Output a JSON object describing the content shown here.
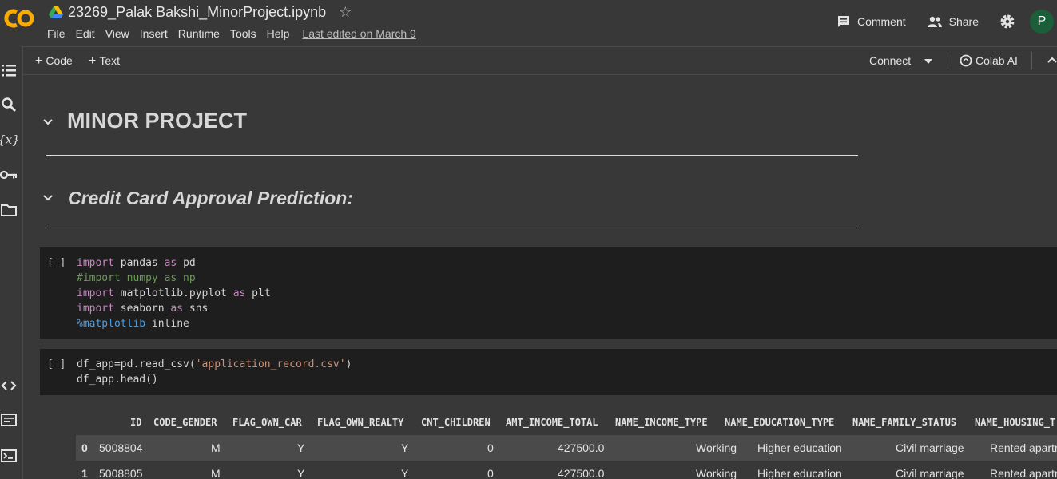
{
  "app": {
    "title": "23269_Palak Bakshi_MinorProject.ipynb",
    "menu": [
      "File",
      "Edit",
      "View",
      "Insert",
      "Runtime",
      "Tools",
      "Help"
    ],
    "last_edited": "Last edited on March 9",
    "comment_label": "Comment",
    "share_label": "Share",
    "avatar_letter": "P",
    "colors": {
      "logo_orange": "#f9ab00",
      "avatar_bg": "#1b5e3a"
    }
  },
  "toolbar": {
    "add_code": "Code",
    "add_text": "Text",
    "connect_label": "Connect",
    "colab_ai_label": "Colab AI"
  },
  "notebook": {
    "heading1": "MINOR PROJECT",
    "heading2": "Credit Card Approval Prediction:",
    "cell1": {
      "run_label": "[ ]",
      "lines": [
        {
          "kw": "import",
          "rest": " pandas ",
          "kw2": "as",
          "rest2": " pd"
        },
        {
          "comment": "#import numpy as np"
        },
        {
          "kw": "import",
          "rest": " matplotlib.pyplot ",
          "kw2": "as",
          "rest2": " plt"
        },
        {
          "kw": "import",
          "rest": " seaborn ",
          "kw2": "as",
          "rest2": " sns"
        },
        {
          "magic": "%matplotlib",
          "rest": " inline"
        }
      ]
    },
    "cell2": {
      "run_label": "[ ]",
      "line1_pre": "df_app=pd.read_csv(",
      "line1_str": "'application_record.csv'",
      "line1_post": ")",
      "line2": "df_app.head()"
    },
    "table": {
      "columns": [
        "ID",
        "CODE_GENDER",
        "FLAG_OWN_CAR",
        "FLAG_OWN_REALTY",
        "CNT_CHILDREN",
        "AMT_INCOME_TOTAL",
        "NAME_INCOME_TYPE",
        "NAME_EDUCATION_TYPE",
        "NAME_FAMILY_STATUS",
        "NAME_HOUSING_T"
      ],
      "rows": [
        {
          "index": "0",
          "cells": [
            "5008804",
            "M",
            "Y",
            "Y",
            "0",
            "427500.0",
            "Working",
            "Higher education",
            "Civil marriage",
            "Rented apartr"
          ]
        },
        {
          "index": "1",
          "cells": [
            "5008805",
            "M",
            "Y",
            "Y",
            "0",
            "427500.0",
            "Working",
            "Higher education",
            "Civil marriage",
            "Rented apartr"
          ]
        }
      ]
    }
  }
}
